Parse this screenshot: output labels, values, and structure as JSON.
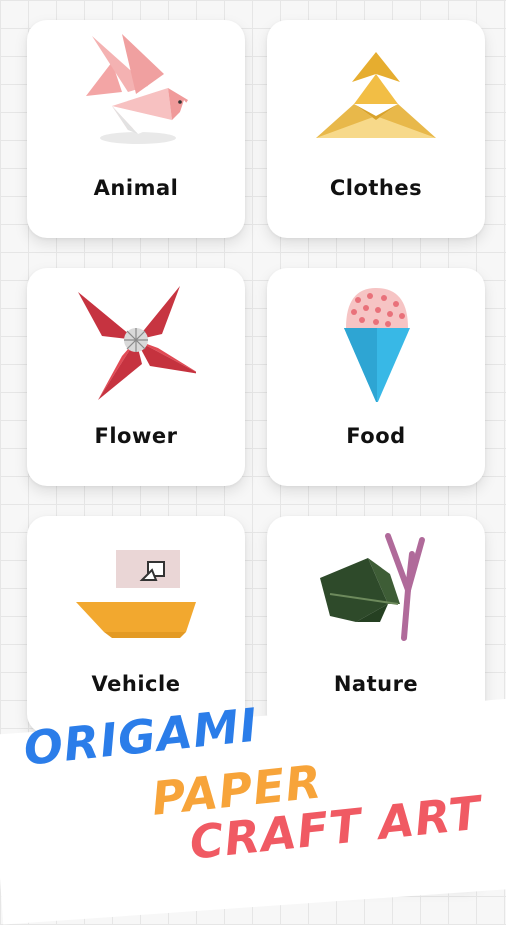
{
  "categories": [
    {
      "label": "Animal",
      "icon": "origami-bird-icon"
    },
    {
      "label": "Clothes",
      "icon": "origami-samurai-hat-icon"
    },
    {
      "label": "Flower",
      "icon": "origami-flower-icon"
    },
    {
      "label": "Food",
      "icon": "origami-ice-cream-icon"
    },
    {
      "label": "Vehicle",
      "icon": "origami-boat-icon"
    },
    {
      "label": "Nature",
      "icon": "origami-leaf-tree-icon"
    }
  ],
  "slogan": {
    "line1": "ORIGAMI",
    "line2": "PAPER",
    "line3": "CRAFT ART",
    "colors": {
      "line1": "#2b7de9",
      "line2": "#f7a43a",
      "line3": "#f05a63"
    }
  }
}
